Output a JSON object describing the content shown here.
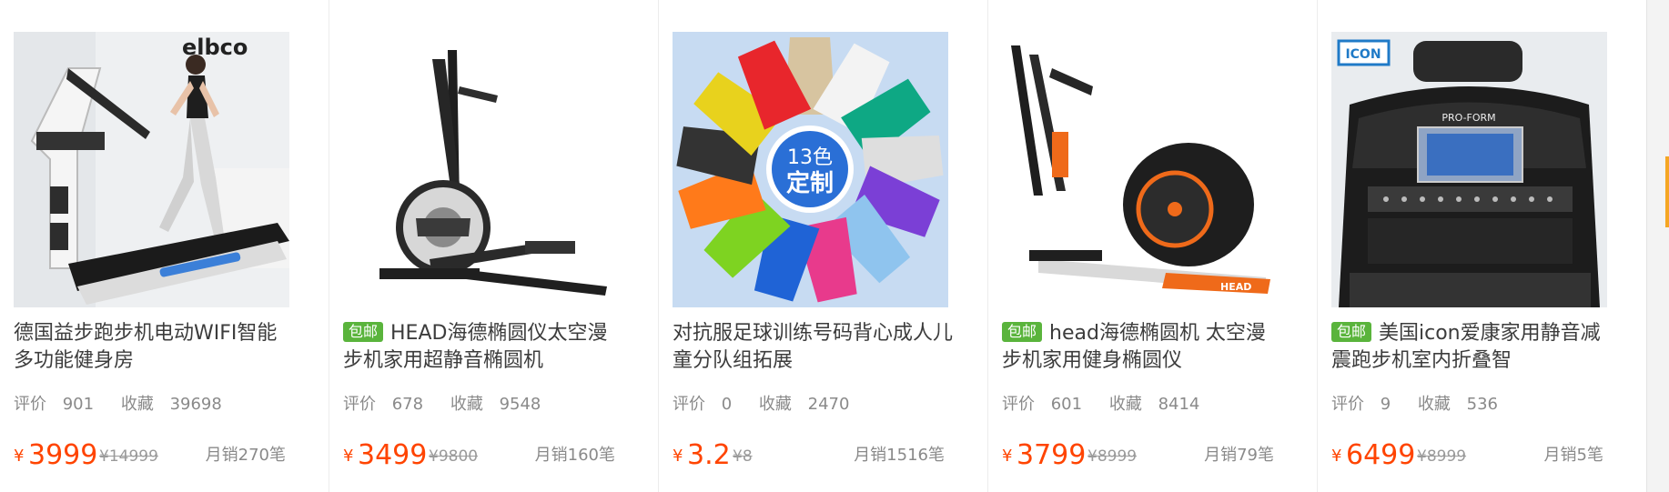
{
  "products": [
    {
      "title": "德国益步跑步机电动WIFI智能多功能健身房",
      "tag": "",
      "reviews_label": "评价",
      "reviews": "901",
      "favorites_label": "收藏",
      "favorites": "39698",
      "currency": "¥",
      "price": "3999",
      "original_price": "¥14999",
      "monthly_sales": "月销270笔",
      "image_icon": "treadmill-icon",
      "brand_logo": "elbco"
    },
    {
      "title": "HEAD海德椭圆仪太空漫步机家用超静音椭圆机",
      "tag": "包邮",
      "reviews_label": "评价",
      "reviews": "678",
      "favorites_label": "收藏",
      "favorites": "9548",
      "currency": "¥",
      "price": "3499",
      "original_price": "¥9800",
      "monthly_sales": "月销160笔",
      "image_icon": "elliptical-trainer-icon"
    },
    {
      "title": "对抗服足球训练号码背心成人儿童分队组拓展",
      "tag": "",
      "reviews_label": "评价",
      "reviews": "0",
      "favorites_label": "收藏",
      "favorites": "2470",
      "currency": "¥",
      "price": "3.2",
      "original_price": "¥8",
      "monthly_sales": "月销1516笔",
      "image_icon": "training-vest-icon",
      "image_center_text_1": "13色",
      "image_center_text_2": "定制"
    },
    {
      "title": "head海德椭圆机 太空漫步机家用健身椭圆仪",
      "tag": "包邮",
      "reviews_label": "评价",
      "reviews": "601",
      "favorites_label": "收藏",
      "favorites": "8414",
      "currency": "¥",
      "price": "3799",
      "original_price": "¥8999",
      "monthly_sales": "月销79笔",
      "image_icon": "elliptical-trainer-icon",
      "brand_text": "HEAD"
    },
    {
      "title": "美国icon爱康家用静音减震跑步机室内折叠智",
      "tag": "包邮",
      "reviews_label": "评价",
      "reviews": "9",
      "favorites_label": "收藏",
      "favorites": "536",
      "currency": "¥",
      "price": "6499",
      "original_price": "¥8999",
      "monthly_sales": "月销5笔",
      "image_icon": "treadmill-console-icon",
      "brand_logo": "ICON",
      "console_brand": "PRO-FORM"
    }
  ],
  "colors": {
    "price": "#ff4400",
    "tag": "#5ab43c",
    "accent_marker": "#f5a623"
  }
}
